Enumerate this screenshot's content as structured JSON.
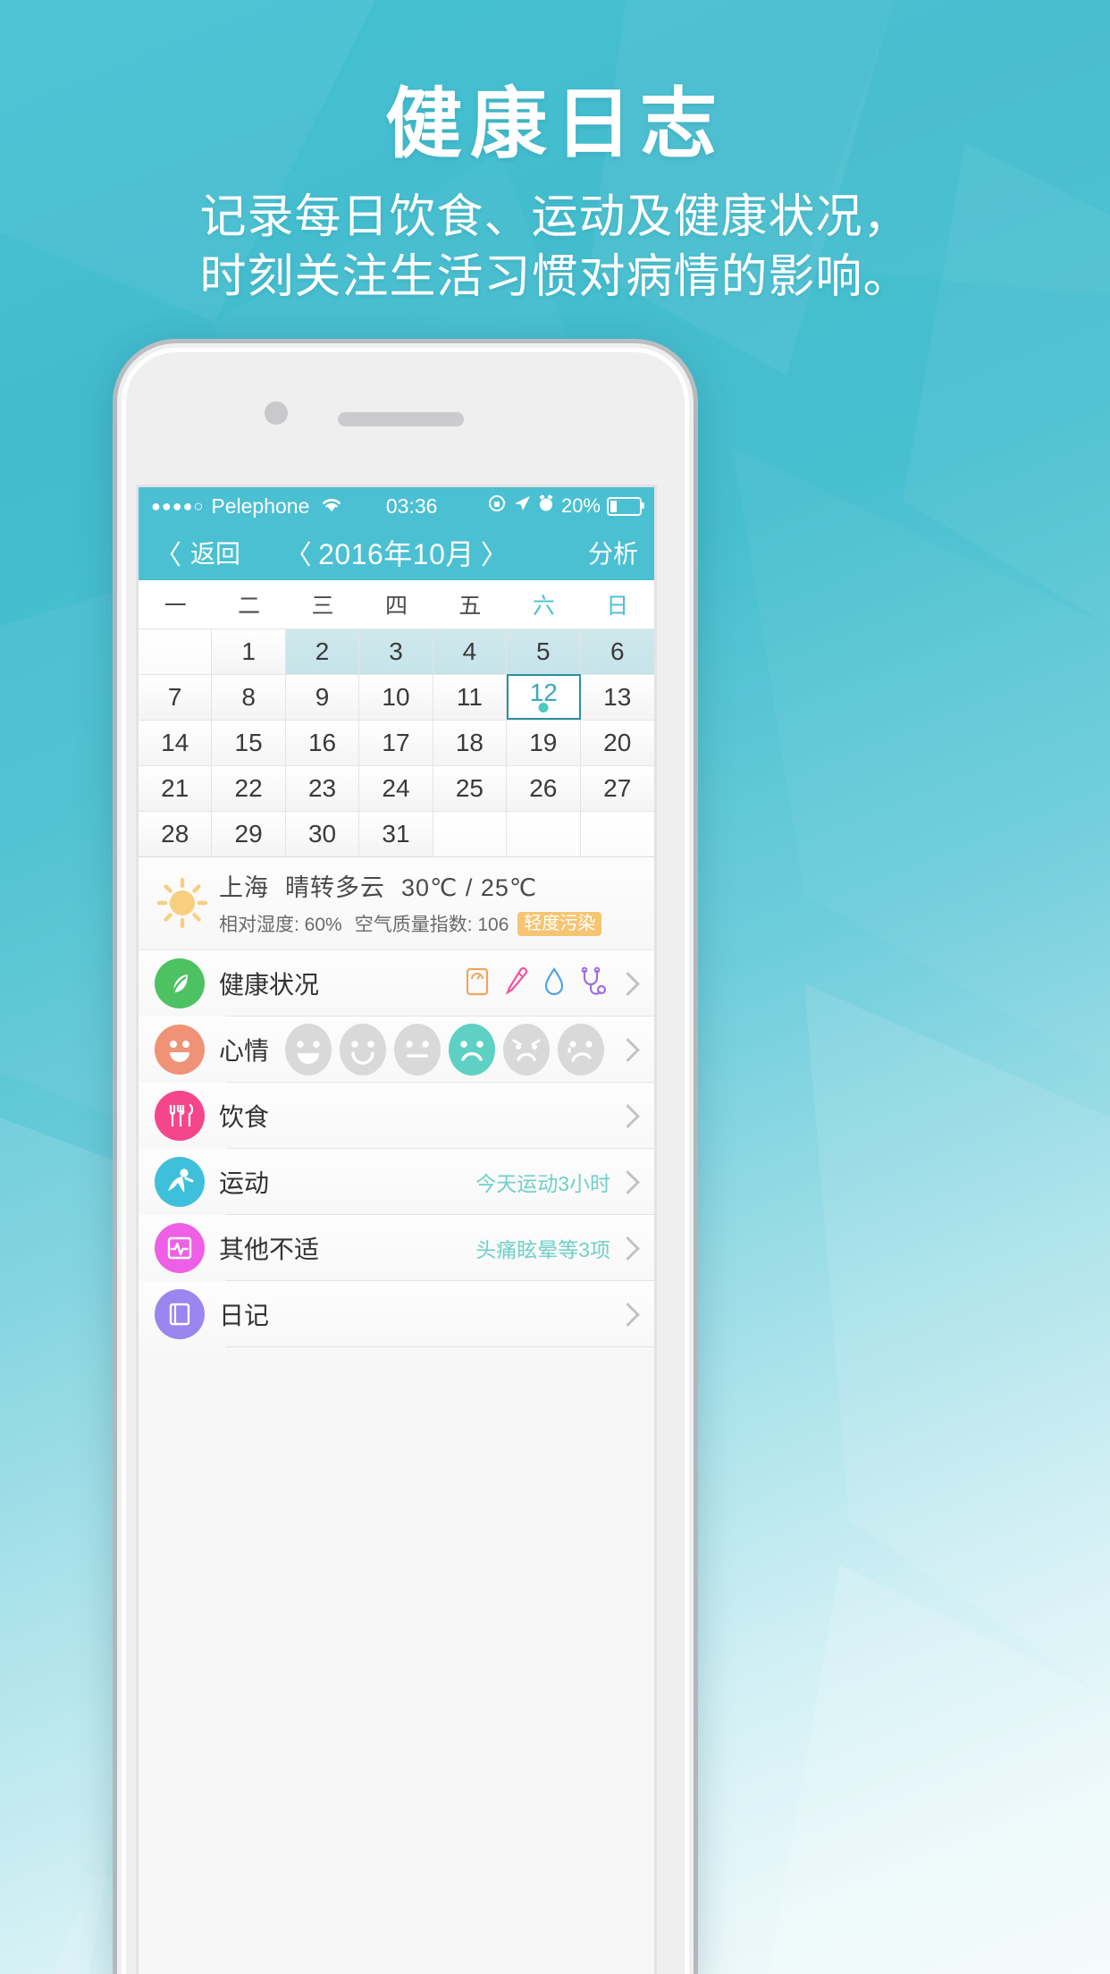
{
  "promo": {
    "title": "健康日志",
    "subtitle_line1": "记录每日饮食、运动及健康状况，",
    "subtitle_line2": "时刻关注生活习惯对病情的影响。",
    "accent_color": "#4bc0d2"
  },
  "status_bar": {
    "signal_dots": "●●●●○",
    "carrier": "Pelephone",
    "wifi_icon": "wifi-icon",
    "time": "03:36",
    "rotation_lock_icon": "rotation-lock-icon",
    "location_icon": "location-arrow-icon",
    "alarm_icon": "alarm-clock-icon",
    "battery_percent": "20%",
    "battery_icon": "battery-icon"
  },
  "nav_bar": {
    "back_label": "返回",
    "back_icon": "chevron-left-icon",
    "prev_month_icon": "chevron-left-icon",
    "title": "2016年10月",
    "next_month_icon": "chevron-right-icon",
    "right_action": "分析"
  },
  "calendar": {
    "weekdays": [
      {
        "label": "一",
        "weekend": false
      },
      {
        "label": "二",
        "weekend": false
      },
      {
        "label": "三",
        "weekend": false
      },
      {
        "label": "四",
        "weekend": false
      },
      {
        "label": "五",
        "weekend": false
      },
      {
        "label": "六",
        "weekend": true
      },
      {
        "label": "日",
        "weekend": true
      }
    ],
    "selected_day": 12,
    "has_entry_days": [
      12
    ],
    "tinted_days": [
      2,
      3,
      4,
      5,
      6
    ],
    "weeks": [
      [
        "",
        "1",
        "2",
        "3",
        "4",
        "5",
        "6"
      ],
      [
        "7",
        "8",
        "9",
        "10",
        "11",
        "12",
        "13"
      ],
      [
        "14",
        "15",
        "16",
        "17",
        "18",
        "19",
        "20"
      ],
      [
        "21",
        "22",
        "23",
        "24",
        "25",
        "26",
        "27"
      ],
      [
        "28",
        "29",
        "30",
        "31",
        "",
        "",
        ""
      ]
    ]
  },
  "weather": {
    "icon": "sun-cloud-icon",
    "city": "上海",
    "condition": "晴转多云",
    "temperature": "30℃ / 25℃",
    "humidity_label": "相对湿度: 60%",
    "aqi_label": "空气质量指数: 106",
    "aqi_badge": "轻度污染",
    "aqi_badge_color": "#f5c572"
  },
  "entries": [
    {
      "name": "health-status",
      "icon": "leaf-icon",
      "icon_color": "#4cc263",
      "label": "健康状况",
      "value": "",
      "mini_icons": [
        {
          "name": "weight-scale-icon",
          "color": "#f0a55c"
        },
        {
          "name": "thermometer-icon",
          "color": "#f2549a"
        },
        {
          "name": "water-drop-icon",
          "color": "#4fa3e8"
        },
        {
          "name": "stethoscope-icon",
          "color": "#a06ee0"
        }
      ]
    },
    {
      "name": "mood",
      "icon": "smiley-face-icon",
      "icon_color": "#ef9275",
      "label": "心情",
      "value": "",
      "selected_face_index": 3,
      "faces": [
        "grin-face-icon",
        "smile-face-icon",
        "neutral-face-icon",
        "frown-face-icon",
        "worried-face-icon",
        "crying-face-icon"
      ]
    },
    {
      "name": "diet",
      "icon": "cutlery-icon",
      "icon_color": "#f5468b",
      "label": "饮食",
      "value": ""
    },
    {
      "name": "exercise",
      "icon": "running-person-icon",
      "icon_color": "#3fc0da",
      "label": "运动",
      "value": "今天运动3小时"
    },
    {
      "name": "other-discomfort",
      "icon": "monitor-pulse-icon",
      "icon_color": "#ef5fe6",
      "label": "其他不适",
      "value": "头痛眩晕等3项"
    },
    {
      "name": "diary",
      "icon": "book-icon",
      "icon_color": "#9b85ee",
      "label": "日记",
      "value": ""
    }
  ],
  "colors": {
    "value_text": "#6fd0c8",
    "nav_bg": "#4bc0d2",
    "selected_cell_border": "#2b8fa3"
  }
}
